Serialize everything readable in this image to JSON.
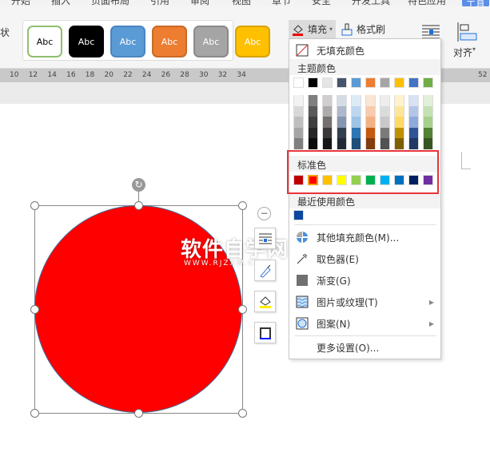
{
  "tabs": [
    "开始",
    "插入",
    "页面布局",
    "引用",
    "审阅",
    "视图",
    "章节",
    "安全",
    "开发工具",
    "特色应用",
    "绘图工具"
  ],
  "ribbon": {
    "left_label": "状",
    "styles": [
      {
        "label": "Abc",
        "bg": "#ffffff",
        "fg": "#000000",
        "border": "#8fbf6e"
      },
      {
        "label": "Abc",
        "bg": "#000000",
        "fg": "#ffffff",
        "border": "#000000"
      },
      {
        "label": "Abc",
        "bg": "#5b9bd5",
        "fg": "#ffffff",
        "border": "#4a86c0"
      },
      {
        "label": "Abc",
        "bg": "#ed7d31",
        "fg": "#ffffff",
        "border": "#c96a28"
      },
      {
        "label": "Abc",
        "bg": "#a5a5a5",
        "fg": "#ffffff",
        "border": "#8a8a8a"
      },
      {
        "label": "Abc",
        "bg": "#ffc000",
        "fg": "#ffffff",
        "border": "#d9a300"
      }
    ],
    "fill_label": "填充",
    "format_painter_label": "格式刷",
    "align_label": "对齐"
  },
  "ruler": [
    "10",
    "12",
    "14",
    "16",
    "18",
    "20",
    "22",
    "24",
    "26",
    "28",
    "30",
    "32",
    "34",
    "52"
  ],
  "menu": {
    "no_fill": "无填充颜色",
    "theme_header": "主题颜色",
    "theme_colors": [
      "#ffffff",
      "#000000",
      "#e7e6e6",
      "#44546a",
      "#5b9bd5",
      "#ed7d31",
      "#a5a5a5",
      "#ffc000",
      "#4472c4",
      "#70ad47"
    ],
    "theme_shades": [
      [
        "#f2f2f2",
        "#7f7f7f",
        "#d0cece",
        "#d6dce4",
        "#deebf6",
        "#fbe5d5",
        "#ededed",
        "#fff2cc",
        "#d9e2f3",
        "#e2efd9"
      ],
      [
        "#d8d8d8",
        "#595959",
        "#aeabab",
        "#adb9ca",
        "#bdd7ee",
        "#f7cbac",
        "#dbdbdb",
        "#fee599",
        "#b4c6e7",
        "#c5e0b3"
      ],
      [
        "#bfbfbf",
        "#3f3f3f",
        "#757070",
        "#8496b0",
        "#9dc3e6",
        "#f4b183",
        "#c9c9c9",
        "#ffd965",
        "#8eaadb",
        "#a8d08d"
      ],
      [
        "#a5a5a5",
        "#262626",
        "#3a3838",
        "#323f4f",
        "#2e75b5",
        "#c55a11",
        "#7b7b7b",
        "#bf9000",
        "#2f5496",
        "#538135"
      ],
      [
        "#7f7f7f",
        "#0c0c0c",
        "#171616",
        "#222a35",
        "#1e4e79",
        "#833c0b",
        "#525252",
        "#7f6000",
        "#1f3864",
        "#375623"
      ]
    ],
    "standard_header": "标准色",
    "standard_colors": [
      "#c00000",
      "#ff0000",
      "#ffc000",
      "#ffff00",
      "#92d050",
      "#00b050",
      "#00b0f0",
      "#0070c0",
      "#002060",
      "#7030a0"
    ],
    "selected_standard": "#ff0000",
    "recent_header": "最近使用颜色",
    "recent_colors": [
      "#0d47a1"
    ],
    "items": [
      {
        "label": "其他填充颜色(M)..."
      },
      {
        "label": "取色器(E)"
      },
      {
        "label": "渐变(G)"
      },
      {
        "label": "图片或纹理(T)",
        "submenu": true
      },
      {
        "label": "图案(N)",
        "submenu": true
      }
    ],
    "more": "更多设置(O)..."
  },
  "shape": {
    "fill": "#ff0000",
    "outline": "#41719c"
  },
  "watermark": {
    "title": "软件自学网",
    "url": "WWW.RJZXW.COM"
  }
}
